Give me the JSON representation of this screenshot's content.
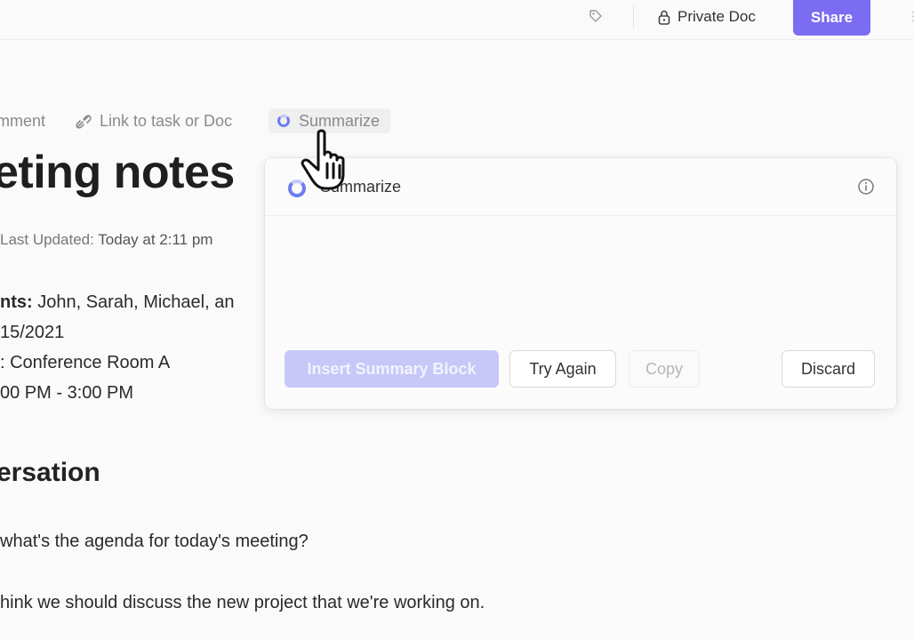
{
  "topbar": {
    "tag_icon": "tag-icon",
    "private_doc_label": "Private Doc",
    "lock_icon": "lock-icon",
    "share_label": "Share",
    "share_color": "#7b6cf2"
  },
  "toolbar": {
    "comment_label": "mment",
    "link_label": "Link to task or Doc",
    "summarize_label": "Summarize"
  },
  "document": {
    "title": "eting notes",
    "last_updated_label": "Last Updated:",
    "last_updated_value": "Today at 2:11 pm",
    "participants_label": "nts:",
    "participants_value": " John, Sarah, Michael, an",
    "date": "15/2021",
    "location": ": Conference Room A",
    "time": "00 PM - 3:00 PM",
    "section_heading": "ersation",
    "line1": " what's the agenda for today's meeting?",
    "line2": "hink we should discuss the new project that we're working on."
  },
  "popup": {
    "title": "Summarize",
    "info_icon": "info-icon",
    "insert_label": "Insert Summary Block",
    "try_again_label": "Try Again",
    "copy_label": "Copy",
    "discard_label": "Discard",
    "accent": "#6d7cf0"
  }
}
